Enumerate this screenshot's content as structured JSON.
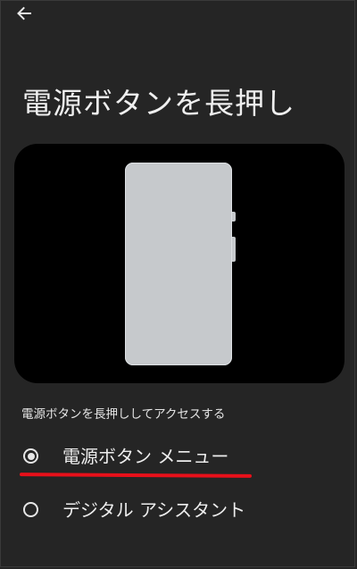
{
  "header": {
    "back_icon": "arrow-left-icon"
  },
  "page": {
    "title": "電源ボタンを長押し"
  },
  "illustration": {
    "icon": "phone-power-button-illustration",
    "colors": {
      "background": "#000000",
      "phone": "#c6c9cc"
    }
  },
  "section": {
    "label": "電源ボタンを長押ししてアクセスする"
  },
  "options": [
    {
      "label": "電源ボタン メニュー",
      "selected": true,
      "icon": "radio-checked-icon"
    },
    {
      "label": "デジタル アシスタント",
      "selected": false,
      "icon": "radio-unchecked-icon"
    }
  ],
  "annotation": {
    "color": "#e8101a"
  },
  "theme": {
    "background": "#252525",
    "text": "#ececec"
  }
}
